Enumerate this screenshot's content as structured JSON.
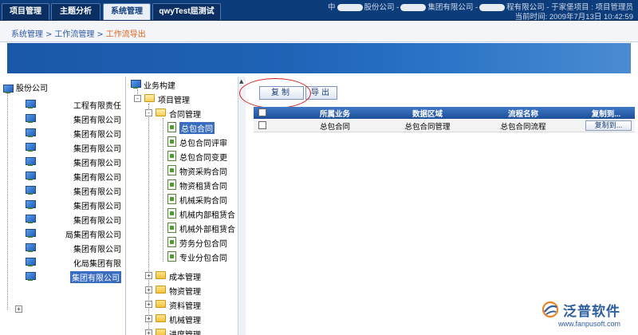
{
  "nav": {
    "tabs": [
      {
        "label": "项目管理",
        "active": false
      },
      {
        "label": "主题分析",
        "active": false
      },
      {
        "label": "系统管理",
        "active": true
      },
      {
        "label": "qwyTest屈测试",
        "active": false
      }
    ]
  },
  "header": {
    "company_prefix": "中",
    "company_part1": "股份公司 -",
    "company_part2": "集团有限公司 -",
    "company_part3": "程有限公司 - 于家堡项目 : 项目管理员",
    "datetime": "当前时间: 2009年7月13日  10:42:59"
  },
  "breadcrumb": {
    "items": [
      "系统管理",
      "工作流管理",
      "工作流导出"
    ],
    "separator": ">"
  },
  "org_tree": {
    "root_label": "股份公司",
    "items": [
      "工程有限责任",
      "集团有限公司",
      "集团有限公司",
      "集团有限公司",
      "集团有限公司",
      "集团有限公司",
      "集团有限公司",
      "集团有限公司",
      "集团有限公司",
      "局集团有限公司",
      "集团有限公司",
      "化局集团有限",
      "集团有限公司"
    ]
  },
  "biz_tree": {
    "root": "业务构建",
    "project_mgmt": "项目管理",
    "contract_mgmt": "合同管理",
    "contracts": [
      "总包合同",
      "总包合同评审",
      "总包合同变更",
      "物资采购合同",
      "物资租赁合同",
      "机械采购合同",
      "机械内部租赁合",
      "机械外部租赁合",
      "劳务分包合同",
      "专业分包合同"
    ],
    "folders": [
      "成本管理",
      "物资管理",
      "资料管理",
      "机械管理",
      "进度管理"
    ]
  },
  "toolbar": {
    "copy_label": "复制",
    "export_label": "导出"
  },
  "grid": {
    "columns": [
      "所属业务",
      "数据区域",
      "流程名称",
      "复制到..."
    ],
    "rows": [
      {
        "business": "总包合同",
        "data_area": "总包合同管理",
        "process": "总包合同流程",
        "action": "复制到..."
      }
    ]
  },
  "watermark": {
    "name": "泛普软件",
    "url": "www.fanpusoft.com"
  }
}
